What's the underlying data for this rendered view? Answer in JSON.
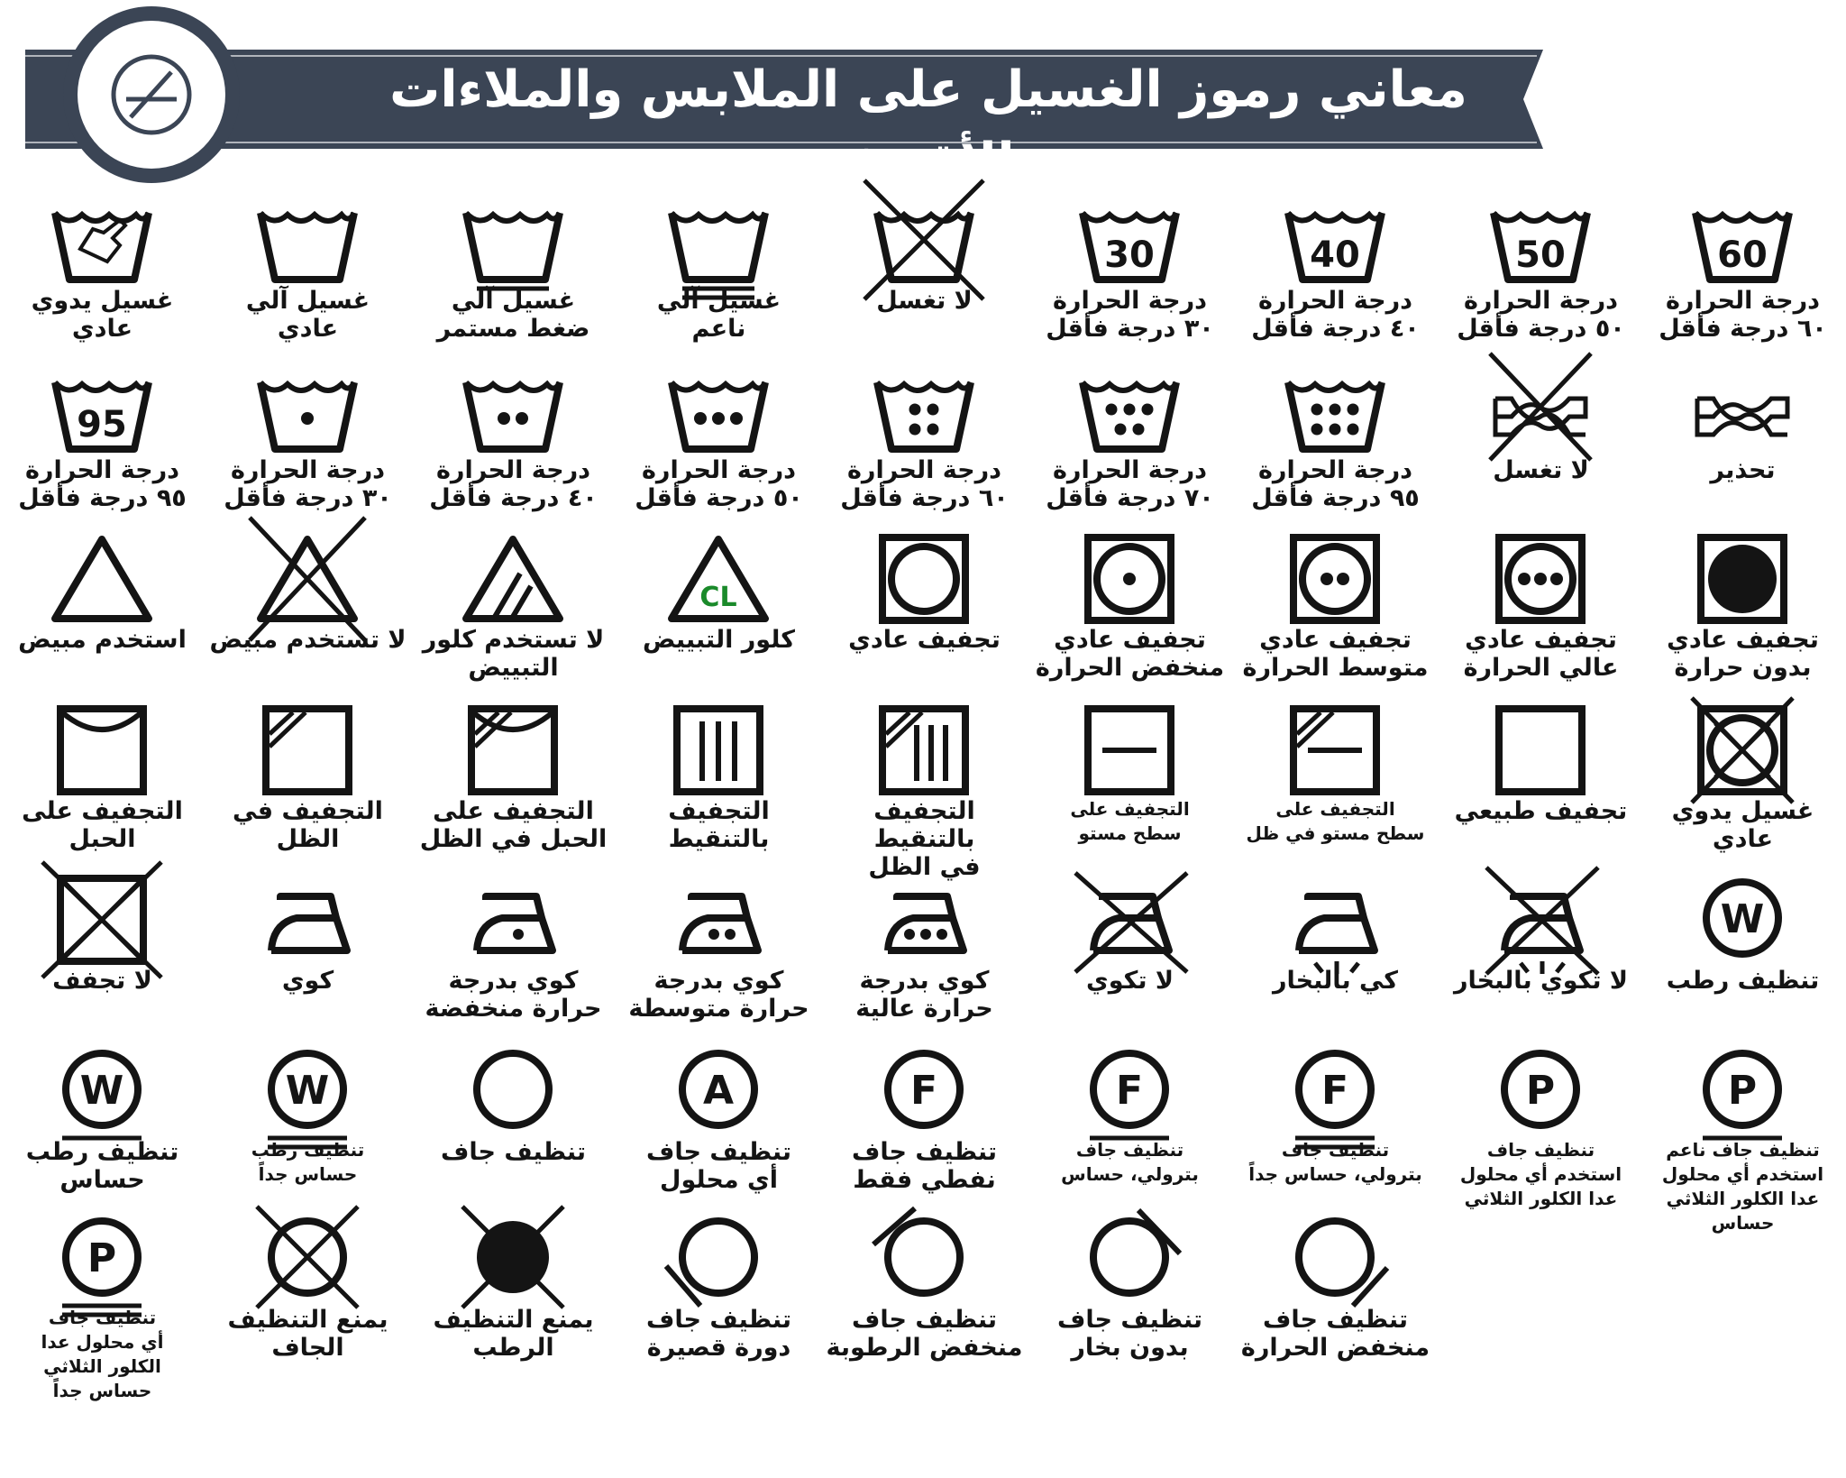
{
  "title": "معاني رموز الغسيل على الملابس والملاءات والأقمشة",
  "colors": {
    "banner": "#3b4555",
    "ink": "#141414",
    "cl_text": "#1a8a2a",
    "background": "#ffffff"
  },
  "rows": [
    [
      {
        "label": "غسيل يدوي\nعادي",
        "icon": "tub-hand-icon"
      },
      {
        "label": "غسيل آلي\nعادي",
        "icon": "tub-icon"
      },
      {
        "label": "غسيل آلي\nضغط مستمر",
        "icon": "tub-permanent-press-icon"
      },
      {
        "label": "غسيل آلي\nناعم",
        "icon": "tub-gentle-icon"
      },
      {
        "label": "لا تغسل",
        "icon": "tub-do-not-wash-icon"
      },
      {
        "label": "درجة الحرارة\n٣٠ درجة فأقل",
        "icon": "tub-30-icon",
        "value": "30"
      },
      {
        "label": "درجة الحرارة\n٤٠ درجة فأقل",
        "icon": "tub-40-icon",
        "value": "40"
      },
      {
        "label": "درجة الحرارة\n٥٠ درجة فأقل",
        "icon": "tub-50-icon",
        "value": "50"
      },
      {
        "label": "درجة الحرارة\n٦٠ درجة فأقل",
        "icon": "tub-60-icon",
        "value": "60"
      }
    ],
    [
      {
        "label": "درجة الحرارة\n٩٥ درجة فأقل",
        "icon": "tub-95-icon",
        "value": "95"
      },
      {
        "label": "درجة الحرارة\n٣٠ درجة فأقل",
        "icon": "tub-one-dot-icon",
        "dots": 1
      },
      {
        "label": "درجة الحرارة\n٤٠ درجة فأقل",
        "icon": "tub-two-dots-icon",
        "dots": 2
      },
      {
        "label": "درجة الحرارة\n٥٠ درجة فأقل",
        "icon": "tub-three-dots-icon",
        "dots": 3
      },
      {
        "label": "درجة الحرارة\n٦٠ درجة فأقل",
        "icon": "tub-four-dots-icon",
        "dots": 4
      },
      {
        "label": "درجة الحرارة\n٧٠ درجة فأقل",
        "icon": "tub-five-dots-icon",
        "dots": 5
      },
      {
        "label": "درجة الحرارة\n٩٥ درجة فأقل",
        "icon": "tub-six-dots-icon",
        "dots": 6
      },
      {
        "label": "لا تغسل",
        "icon": "do-not-wring-icon"
      },
      {
        "label": "تحذير",
        "icon": "wring-icon"
      }
    ],
    [
      {
        "label": "استخدم مبيض",
        "icon": "bleach-triangle-icon"
      },
      {
        "label": "لا تستخدم مبيض",
        "icon": "no-bleach-icon"
      },
      {
        "label": "لا تستخدم كلور\nالتبييض",
        "icon": "non-chlorine-bleach-icon"
      },
      {
        "label": "كلور التبييض",
        "icon": "chlorine-bleach-icon",
        "text": "CL"
      },
      {
        "label": "تجفيف عادي",
        "icon": "tumble-dry-icon"
      },
      {
        "label": "تجفيف عادي\nمنخفض الحرارة",
        "icon": "tumble-dry-low-icon",
        "dots": 1
      },
      {
        "label": "تجفيف عادي\nمتوسط الحرارة",
        "icon": "tumble-dry-medium-icon",
        "dots": 2
      },
      {
        "label": "تجفيف عادي\nعالي الحرارة",
        "icon": "tumble-dry-high-icon",
        "dots": 3
      },
      {
        "label": "تجفيف عادي\nبدون حرارة",
        "icon": "tumble-dry-no-heat-icon"
      }
    ],
    [
      {
        "label": "التجفيف على\nالحبل",
        "icon": "line-dry-icon"
      },
      {
        "label": "التجفيف في\nالظل",
        "icon": "dry-in-shade-icon"
      },
      {
        "label": "التجفيف على\nالحبل في الظل",
        "icon": "line-dry-shade-icon"
      },
      {
        "label": "التجفيف بالتنقيط",
        "icon": "drip-dry-icon"
      },
      {
        "label": "التجفيف بالتنقيط\nفي الظل",
        "icon": "drip-dry-shade-icon"
      },
      {
        "label": "التجفيف على\nسطح مستو",
        "icon": "dry-flat-icon",
        "small": true
      },
      {
        "label": "التجفيف على\nسطح مستو في ظل",
        "icon": "dry-flat-shade-icon",
        "small": true
      },
      {
        "label": "تجفيف طبيعي",
        "icon": "natural-dry-icon"
      },
      {
        "label": "غسيل يدوي\nعادي",
        "icon": "do-not-tumble-dry-icon"
      }
    ],
    [
      {
        "label": "لا تجفف",
        "icon": "do-not-dry-icon"
      },
      {
        "label": "كوي",
        "icon": "iron-icon"
      },
      {
        "label": "كوي بدرجة\nحرارة منخفضة",
        "icon": "iron-low-icon",
        "dots": 1
      },
      {
        "label": "كوي بدرجة\nحرارة متوسطة",
        "icon": "iron-medium-icon",
        "dots": 2
      },
      {
        "label": "كوي بدرجة\nحرارة عالية",
        "icon": "iron-high-icon",
        "dots": 3
      },
      {
        "label": "لا تكوي",
        "icon": "do-not-iron-icon"
      },
      {
        "label": "كي بالبخار",
        "icon": "steam-iron-icon"
      },
      {
        "label": "لا تكوي بالبخار",
        "icon": "no-steam-icon"
      },
      {
        "label": "تنظيف رطب",
        "icon": "wet-clean-icon",
        "text": "W"
      }
    ],
    [
      {
        "label": "تنظيف رطب\nحساس",
        "icon": "wet-clean-gentle-icon",
        "text": "W",
        "bars": 1
      },
      {
        "label": "تنظيف رطب\nحساس جداً",
        "icon": "wet-clean-very-gentle-icon",
        "text": "W",
        "bars": 2,
        "small": true
      },
      {
        "label": "تنظيف جاف",
        "icon": "dry-clean-icon"
      },
      {
        "label": "تنظيف جاف\nأي محلول",
        "icon": "dry-clean-any-icon",
        "text": "A"
      },
      {
        "label": "تنظيف جاف\nنفطي فقط",
        "icon": "dry-clean-petroleum-icon",
        "text": "F"
      },
      {
        "label": "تنظيف جاف\nبترولي، حساس",
        "icon": "dry-clean-petroleum-gentle-icon",
        "text": "F",
        "bars": 1,
        "small": true
      },
      {
        "label": "تنظيف جاف\nبترولي، حساس جداً",
        "icon": "dry-clean-petroleum-very-gentle-icon",
        "text": "F",
        "bars": 2,
        "small": true
      },
      {
        "label": "تنظيف جاف\nاستخدم أي محلول\nعدا الكلور الثلاثي",
        "icon": "dry-clean-p-icon",
        "text": "P",
        "small": true
      },
      {
        "label": "تنظيف جاف ناعم\nاستخدم أي محلول\nعدا الكلور الثلاثي\nحساس",
        "icon": "dry-clean-p-gentle-icon",
        "text": "P",
        "small": true
      }
    ],
    [
      {
        "label": "تنظيف جاف\nأي محلول عدا\nالكلور الثلاثي\nحساس جداً",
        "icon": "dry-clean-p-very-gentle-icon",
        "text": "P",
        "bars": 2,
        "small": true
      },
      {
        "label": "يمنع التنظيف\nالجاف",
        "icon": "do-not-dry-clean-icon"
      },
      {
        "label": "يمنع التنظيف\nالرطب",
        "icon": "do-not-wet-clean-icon"
      },
      {
        "label": "تنظيف جاف\nدورة قصيرة",
        "icon": "short-cycle-icon"
      },
      {
        "label": "تنظيف جاف\nمنخفض الرطوبة",
        "icon": "reduced-moisture-icon"
      },
      {
        "label": "تنظيف جاف\nبدون بخار",
        "icon": "no-steam-dry-clean-icon"
      },
      {
        "label": "تنظيف جاف\nمنخفض الحرارة",
        "icon": "low-heat-dry-clean-icon"
      }
    ]
  ]
}
